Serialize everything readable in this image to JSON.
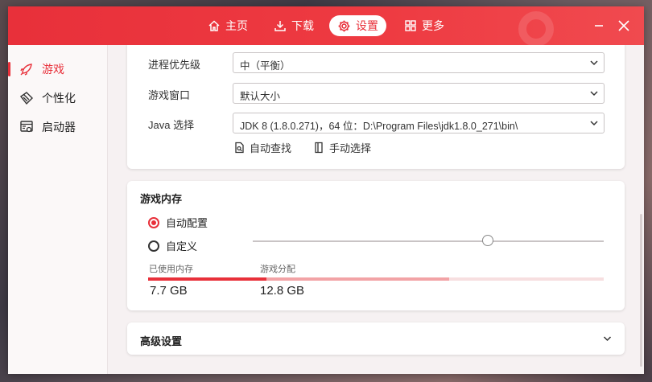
{
  "nav": {
    "home": "主页",
    "download": "下载",
    "settings": "设置",
    "more": "更多"
  },
  "sidebar": {
    "items": [
      {
        "label": "游戏",
        "icon": "rocket-icon",
        "active": true
      },
      {
        "label": "个性化",
        "icon": "brush-icon",
        "active": false
      },
      {
        "label": "启动器",
        "icon": "launcher-settings-icon",
        "active": false
      }
    ]
  },
  "launch": {
    "priority_label": "进程优先级",
    "priority_value": "中（平衡）",
    "window_label": "游戏窗口",
    "window_value": "默认大小",
    "java_label": "Java 选择",
    "java_value": "JDK 8 (1.8.0.271)，64 位：D:\\Program Files\\jdk1.8.0_271\\bin\\",
    "auto_find": "自动查找",
    "manual_select": "手动选择"
  },
  "memory": {
    "title": "游戏内存",
    "auto_option": "自动配置",
    "custom_option": "自定义",
    "selected": "auto",
    "slider_level": 0.67,
    "used_label": "已使用内存",
    "used_value": "7.7 GB",
    "alloc_label": "游戏分配",
    "alloc_value": "12.8 GB",
    "used_fraction": 0.26,
    "alloc_fraction": 0.66
  },
  "advanced": {
    "title": "高级设置"
  },
  "colors": {
    "accent": "#e8303a",
    "titlebar": "#ee3b42",
    "alloc_bar": "#f2a3a6"
  }
}
